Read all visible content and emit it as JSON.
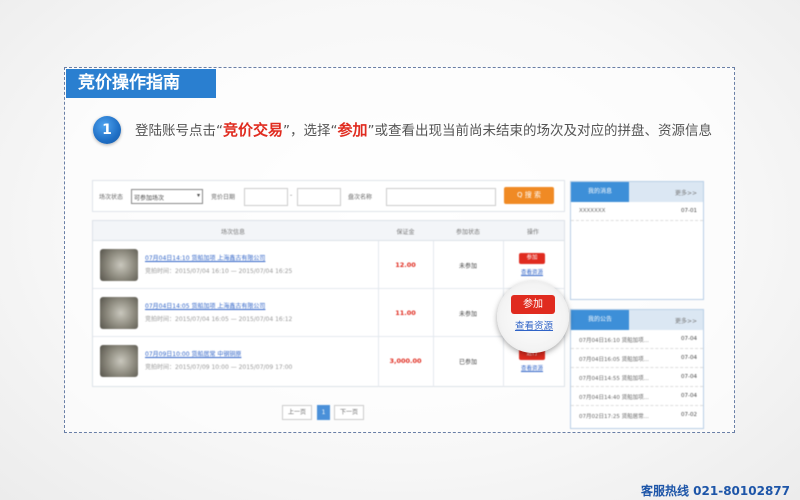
{
  "guide": {
    "title": "竞价操作指南",
    "step_number": "1",
    "instruction": {
      "part1": "登陆账号点击“",
      "highlight1": "竞价交易",
      "part2": "”，选择“",
      "highlight2": "参加",
      "part3": "”或查看出现当前尚未结束的场次及对应的拼盘、资源信息"
    }
  },
  "screenshot": {
    "filter": {
      "status_label": "场次状态",
      "status_value": "可参加场次",
      "date_label": "竞价日期",
      "date_sep": "-",
      "name_label": "盘次名称",
      "search_button": "Q 搜 索"
    },
    "table": {
      "headers": [
        "场次信息",
        "保证金",
        "参加状态",
        "操作"
      ],
      "rows": [
        {
          "title": "07月04日14:10 货船加项 上海鑫古有限公司",
          "time": "竞拍时间：2015/07/04 16:10 — 2015/07/04 16:25",
          "price": "12.00",
          "state": "未参加",
          "action": "参加",
          "link": "查看资源"
        },
        {
          "title": "07月04日14:05 货船加项 上海鑫古有限公司",
          "time": "竞拍时间：2015/07/04 16:05 — 2015/07/04 16:12",
          "price": "11.00",
          "state": "未参加",
          "action": "参加",
          "link": "查看资源"
        },
        {
          "title": "07月09日10:00 货船居常 中钢铜原",
          "time": "竞拍时间：2015/07/09 10:00 — 2015/07/09 17:00",
          "price": "3,000.00",
          "state": "已参加",
          "action": "进行",
          "link": "查看资源"
        }
      ]
    },
    "pager": {
      "prev": "上一页",
      "current": "1",
      "next": "下一页"
    }
  },
  "side_top": {
    "tab": "我的消息",
    "more": "更多>>",
    "items": [
      {
        "title": "XXXXXXX",
        "date": "07-01"
      }
    ]
  },
  "side_bottom": {
    "tab": "我的公告",
    "more": "更多>>",
    "items": [
      {
        "title": "07月04日16:10 货船加项...",
        "date": "07-04"
      },
      {
        "title": "07月04日16:05 货船加项...",
        "date": "07-04"
      },
      {
        "title": "07月04日14:55 货船加项...",
        "date": "07-04"
      },
      {
        "title": "07月04日14:40 货船加项...",
        "date": "07-04"
      },
      {
        "title": "07月02日17:25 货船居常...",
        "date": "07-02"
      }
    ]
  },
  "magnified": {
    "join": "参加",
    "view": "查看资源"
  },
  "hotline": "客服热线  021-80102877",
  "colors": {
    "brand": "#2a7fd0",
    "highlight": "#e02b1f",
    "link": "#2f63c7",
    "search": "#f08a24"
  }
}
